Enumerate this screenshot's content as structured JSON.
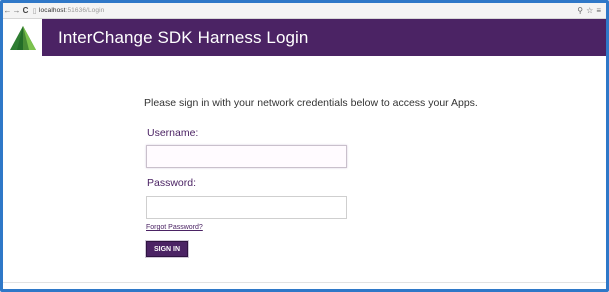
{
  "browser": {
    "back_icon": "←",
    "forward_icon": "→",
    "reload_icon": "C",
    "page_icon": "▯",
    "url_host": "localhost",
    "url_port": ":51636/Login",
    "zoom_icon": "⚲",
    "star_icon": "☆",
    "menu_icon": "≡"
  },
  "header": {
    "title": "InterChange SDK Harness Login"
  },
  "login": {
    "intro": "Please sign in with your network credentials below to access your Apps.",
    "username_label": "Username:",
    "username_value": "",
    "password_label": "Password:",
    "password_value": "",
    "forgot_link": "Forgot Password?",
    "signin_button": "SIGN IN"
  },
  "colors": {
    "brand": "#4b2364",
    "frame": "#2f78c8",
    "logo_green": "#43a047"
  }
}
